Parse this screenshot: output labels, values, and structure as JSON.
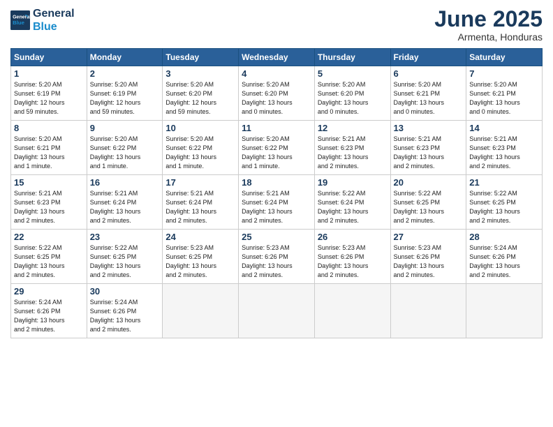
{
  "header": {
    "logo_line1": "General",
    "logo_line2": "Blue",
    "month": "June 2025",
    "location": "Armenta, Honduras"
  },
  "days_of_week": [
    "Sunday",
    "Monday",
    "Tuesday",
    "Wednesday",
    "Thursday",
    "Friday",
    "Saturday"
  ],
  "weeks": [
    [
      {
        "day": 1,
        "info": "Sunrise: 5:20 AM\nSunset: 6:19 PM\nDaylight: 12 hours\nand 59 minutes."
      },
      {
        "day": 2,
        "info": "Sunrise: 5:20 AM\nSunset: 6:19 PM\nDaylight: 12 hours\nand 59 minutes."
      },
      {
        "day": 3,
        "info": "Sunrise: 5:20 AM\nSunset: 6:20 PM\nDaylight: 12 hours\nand 59 minutes."
      },
      {
        "day": 4,
        "info": "Sunrise: 5:20 AM\nSunset: 6:20 PM\nDaylight: 13 hours\nand 0 minutes."
      },
      {
        "day": 5,
        "info": "Sunrise: 5:20 AM\nSunset: 6:20 PM\nDaylight: 13 hours\nand 0 minutes."
      },
      {
        "day": 6,
        "info": "Sunrise: 5:20 AM\nSunset: 6:21 PM\nDaylight: 13 hours\nand 0 minutes."
      },
      {
        "day": 7,
        "info": "Sunrise: 5:20 AM\nSunset: 6:21 PM\nDaylight: 13 hours\nand 0 minutes."
      }
    ],
    [
      {
        "day": 8,
        "info": "Sunrise: 5:20 AM\nSunset: 6:21 PM\nDaylight: 13 hours\nand 1 minute."
      },
      {
        "day": 9,
        "info": "Sunrise: 5:20 AM\nSunset: 6:22 PM\nDaylight: 13 hours\nand 1 minute."
      },
      {
        "day": 10,
        "info": "Sunrise: 5:20 AM\nSunset: 6:22 PM\nDaylight: 13 hours\nand 1 minute."
      },
      {
        "day": 11,
        "info": "Sunrise: 5:20 AM\nSunset: 6:22 PM\nDaylight: 13 hours\nand 1 minute."
      },
      {
        "day": 12,
        "info": "Sunrise: 5:21 AM\nSunset: 6:23 PM\nDaylight: 13 hours\nand 2 minutes."
      },
      {
        "day": 13,
        "info": "Sunrise: 5:21 AM\nSunset: 6:23 PM\nDaylight: 13 hours\nand 2 minutes."
      },
      {
        "day": 14,
        "info": "Sunrise: 5:21 AM\nSunset: 6:23 PM\nDaylight: 13 hours\nand 2 minutes."
      }
    ],
    [
      {
        "day": 15,
        "info": "Sunrise: 5:21 AM\nSunset: 6:23 PM\nDaylight: 13 hours\nand 2 minutes."
      },
      {
        "day": 16,
        "info": "Sunrise: 5:21 AM\nSunset: 6:24 PM\nDaylight: 13 hours\nand 2 minutes."
      },
      {
        "day": 17,
        "info": "Sunrise: 5:21 AM\nSunset: 6:24 PM\nDaylight: 13 hours\nand 2 minutes."
      },
      {
        "day": 18,
        "info": "Sunrise: 5:21 AM\nSunset: 6:24 PM\nDaylight: 13 hours\nand 2 minutes."
      },
      {
        "day": 19,
        "info": "Sunrise: 5:22 AM\nSunset: 6:24 PM\nDaylight: 13 hours\nand 2 minutes."
      },
      {
        "day": 20,
        "info": "Sunrise: 5:22 AM\nSunset: 6:25 PM\nDaylight: 13 hours\nand 2 minutes."
      },
      {
        "day": 21,
        "info": "Sunrise: 5:22 AM\nSunset: 6:25 PM\nDaylight: 13 hours\nand 2 minutes."
      }
    ],
    [
      {
        "day": 22,
        "info": "Sunrise: 5:22 AM\nSunset: 6:25 PM\nDaylight: 13 hours\nand 2 minutes."
      },
      {
        "day": 23,
        "info": "Sunrise: 5:22 AM\nSunset: 6:25 PM\nDaylight: 13 hours\nand 2 minutes."
      },
      {
        "day": 24,
        "info": "Sunrise: 5:23 AM\nSunset: 6:25 PM\nDaylight: 13 hours\nand 2 minutes."
      },
      {
        "day": 25,
        "info": "Sunrise: 5:23 AM\nSunset: 6:26 PM\nDaylight: 13 hours\nand 2 minutes."
      },
      {
        "day": 26,
        "info": "Sunrise: 5:23 AM\nSunset: 6:26 PM\nDaylight: 13 hours\nand 2 minutes."
      },
      {
        "day": 27,
        "info": "Sunrise: 5:23 AM\nSunset: 6:26 PM\nDaylight: 13 hours\nand 2 minutes."
      },
      {
        "day": 28,
        "info": "Sunrise: 5:24 AM\nSunset: 6:26 PM\nDaylight: 13 hours\nand 2 minutes."
      }
    ],
    [
      {
        "day": 29,
        "info": "Sunrise: 5:24 AM\nSunset: 6:26 PM\nDaylight: 13 hours\nand 2 minutes."
      },
      {
        "day": 30,
        "info": "Sunrise: 5:24 AM\nSunset: 6:26 PM\nDaylight: 13 hours\nand 2 minutes."
      },
      null,
      null,
      null,
      null,
      null
    ]
  ]
}
